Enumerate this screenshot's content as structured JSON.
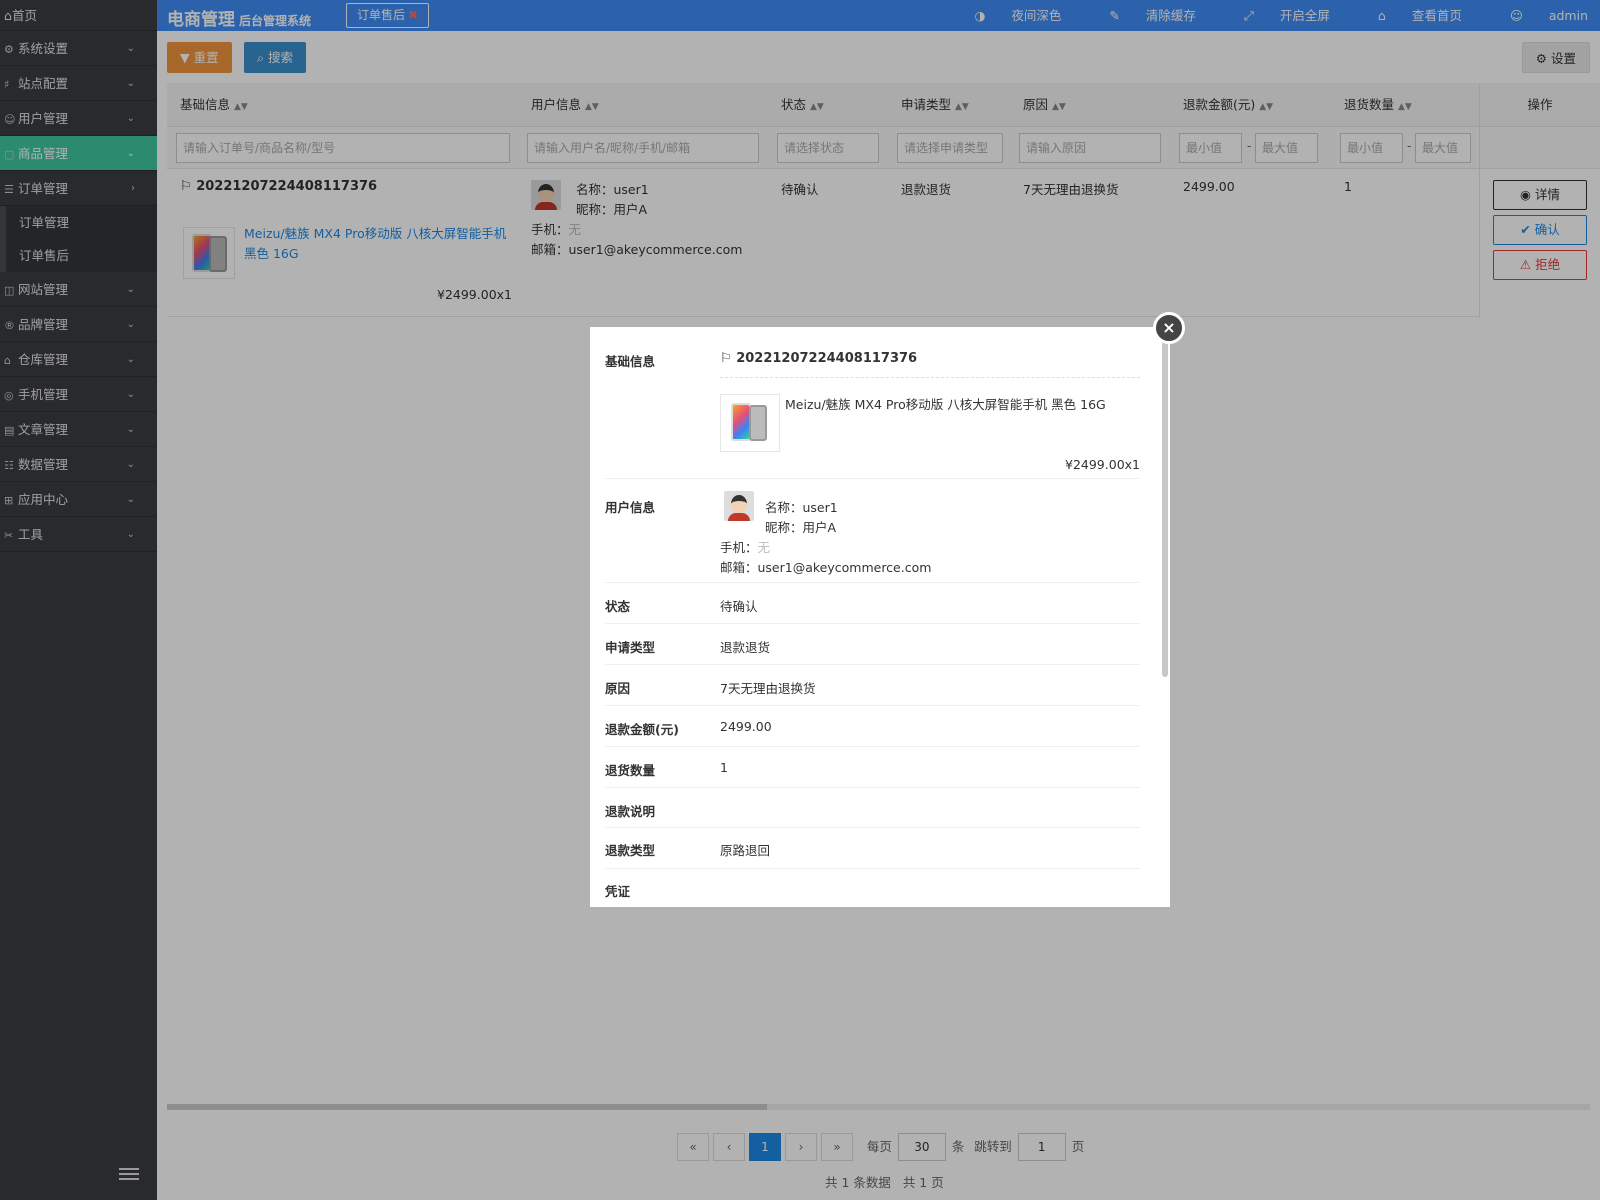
{
  "sidebar": {
    "home": "首页",
    "items": [
      {
        "label": "系统设置",
        "icon": "gear-icon"
      },
      {
        "label": "站点配置",
        "icon": "sliders-icon"
      },
      {
        "label": "用户管理",
        "icon": "user-icon"
      },
      {
        "label": "商品管理",
        "icon": "box-icon",
        "active": true
      },
      {
        "label": "订单管理",
        "icon": "list-icon",
        "expanded": true
      }
    ],
    "sub_items": [
      "订单管理",
      "订单售后"
    ],
    "items_after": [
      {
        "label": "网站管理",
        "icon": "browser-icon"
      },
      {
        "label": "品牌管理",
        "icon": "registered-icon"
      },
      {
        "label": "仓库管理",
        "icon": "warehouse-icon"
      },
      {
        "label": "手机管理",
        "icon": "phone-icon"
      },
      {
        "label": "文章管理",
        "icon": "document-icon"
      },
      {
        "label": "数据管理",
        "icon": "database-icon"
      },
      {
        "label": "应用中心",
        "icon": "grid-icon"
      },
      {
        "label": "工具",
        "icon": "tools-icon"
      }
    ]
  },
  "topbar": {
    "brand": "电商管理",
    "brand_sub": "后台管理系统",
    "tab": "订单售后",
    "links": [
      "夜间深色",
      "清除缓存",
      "开启全屏",
      "查看首页",
      "admin"
    ]
  },
  "toolbar": {
    "reset": "重置",
    "search": "搜索",
    "settings": "设置"
  },
  "table": {
    "headers": [
      "基础信息",
      "用户信息",
      "状态",
      "申请类型",
      "原因",
      "退款金额(元)",
      "退货数量",
      "操作"
    ],
    "filters": {
      "basic": "请输入订单号/商品名称/型号",
      "user": "请输入用户名/昵称/手机/邮箱",
      "status": "请选择状态",
      "type": "请选择申请类型",
      "reason": "请输入原因",
      "min": "最小值",
      "max": "最大值",
      "dash": "-"
    },
    "row": {
      "order_no": "20221207224408117376",
      "goods_name_1": "Meizu/魅族 MX4 Pro移动版 八核大屏智能手机",
      "goods_name_2": "黑色 16G",
      "goods_price": "¥2499.00x1",
      "user_name": "名称：user1",
      "user_nick": "昵称：用户A",
      "user_phone_label": "手机：",
      "user_phone": "无",
      "user_email": "邮箱：user1@akeycommerce.com",
      "status": "待确认",
      "type": "退款退货",
      "reason": "7天无理由退换货",
      "amount": "2499.00",
      "qty": "1"
    },
    "actions": {
      "detail": "详情",
      "confirm": "确认",
      "reject": "拒绝"
    }
  },
  "pagination": {
    "first": "«",
    "prev": "‹",
    "current": "1",
    "next": "›",
    "last": "»",
    "per_page_label": "每页",
    "per_page": "30",
    "per_unit": "条",
    "jump_label": "跳转到",
    "jump_page": "1",
    "page_unit": "页",
    "summary": "共 1 条数据   共 1 页"
  },
  "modal": {
    "close": "×",
    "basic_label": "基础信息",
    "order_no": "20221207224408117376",
    "goods_name": "Meizu/魅族 MX4 Pro移动版 八核大屏智能手机 黑色 16G",
    "goods_price": "¥2499.00x1",
    "user_label": "用户信息",
    "user_name": "名称：user1",
    "user_nick": "昵称：用户A",
    "user_phone_label": "手机：",
    "user_phone": "无",
    "user_email": "邮箱：user1@akeycommerce.com",
    "status_label": "状态",
    "status": "待确认",
    "type_label": "申请类型",
    "type": "退款退货",
    "reason_label": "原因",
    "reason": "7天无理由退换货",
    "amount_label": "退款金额(元)",
    "amount": "2499.00",
    "qty_label": "退货数量",
    "qty": "1",
    "note_label": "退款说明",
    "note": "",
    "refund_type_label": "退款类型",
    "refund_type": "原路退回",
    "voucher_label": "凭证"
  }
}
